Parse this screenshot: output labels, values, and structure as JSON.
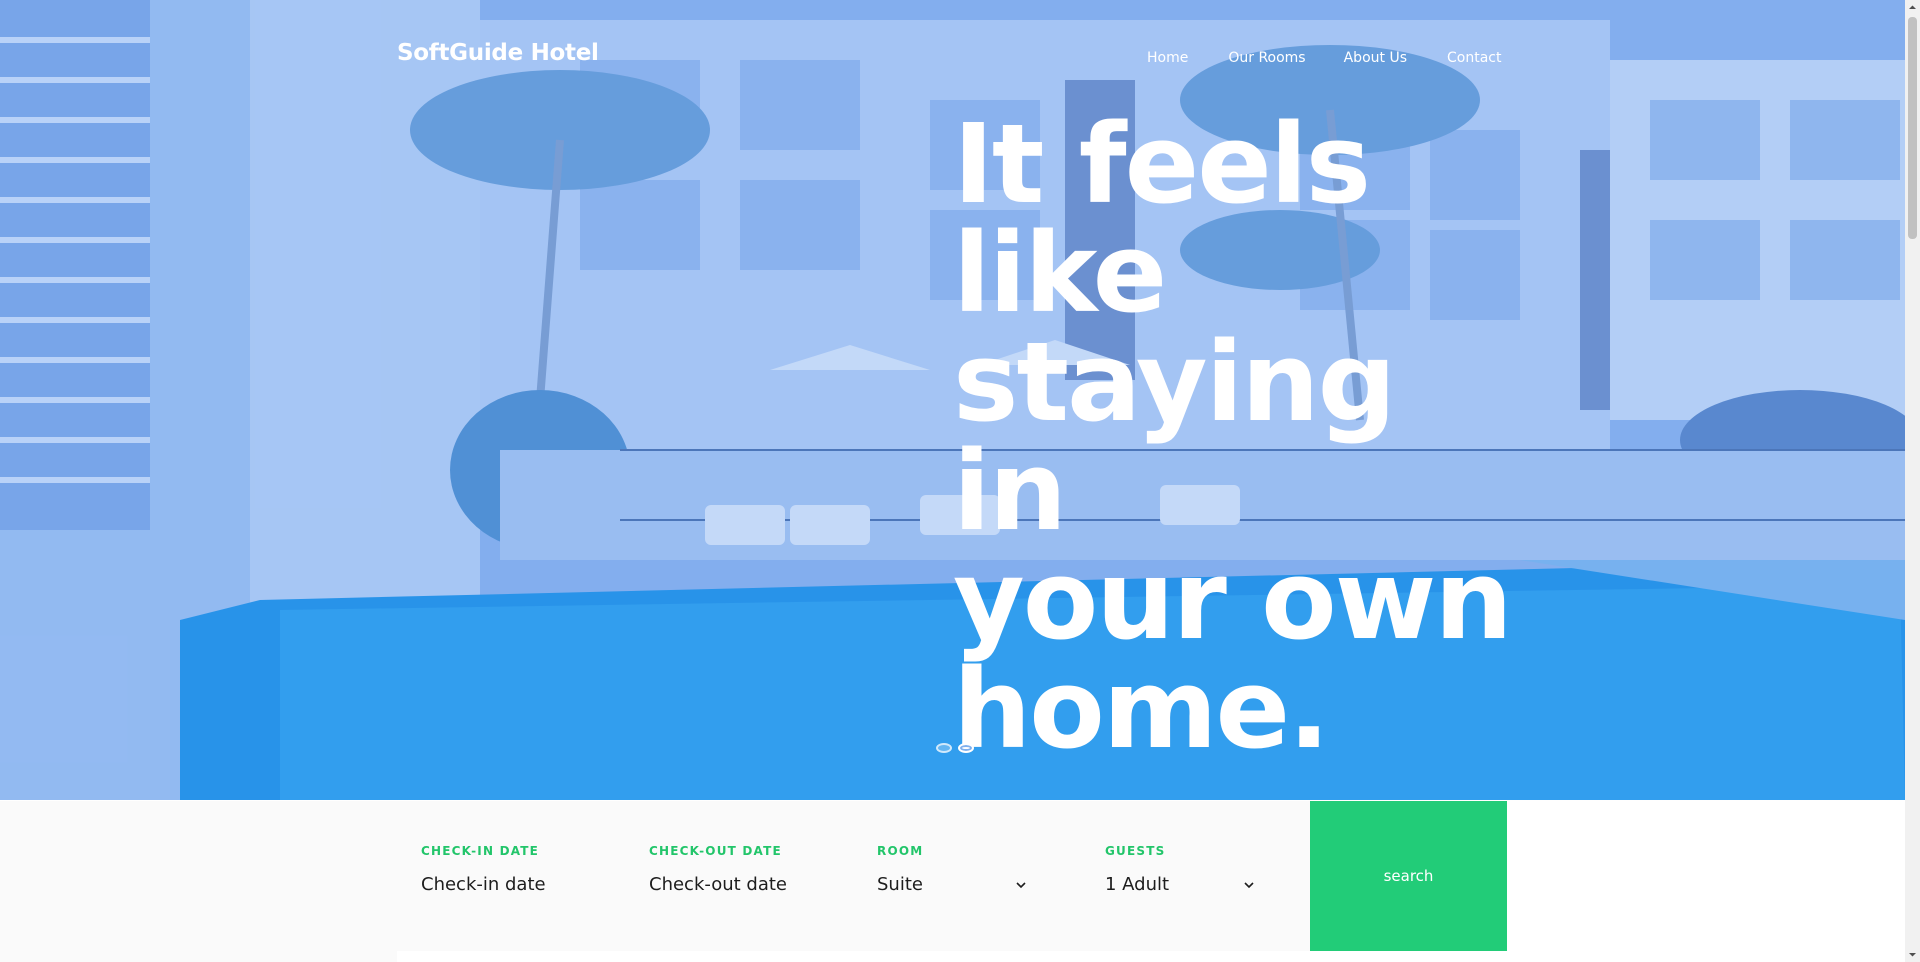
{
  "brand": {
    "name": "SoftGuide Hotel"
  },
  "nav": {
    "items": [
      {
        "label": "Home"
      },
      {
        "label": "Our Rooms"
      },
      {
        "label": "About Us"
      },
      {
        "label": "Contact"
      }
    ]
  },
  "hero": {
    "headline_lines": [
      "It feels",
      "like",
      "staying in",
      "your own",
      "home."
    ],
    "slides": {
      "count": 2,
      "active": 2
    }
  },
  "booking": {
    "checkin": {
      "label": "CHECK-IN DATE",
      "placeholder": "Check-in date"
    },
    "checkout": {
      "label": "CHECK-OUT DATE",
      "placeholder": "Check-out date"
    },
    "room": {
      "label": "ROOM",
      "value": "Suite",
      "icon": "chevron-down-icon"
    },
    "guests": {
      "label": "GUESTS",
      "value": "1 Adult",
      "icon": "chevron-down-icon"
    },
    "search_label": "search"
  },
  "colors": {
    "accent": "#22cc78",
    "label_green": "#22c56a",
    "hero_tint": "#5a96f0"
  }
}
